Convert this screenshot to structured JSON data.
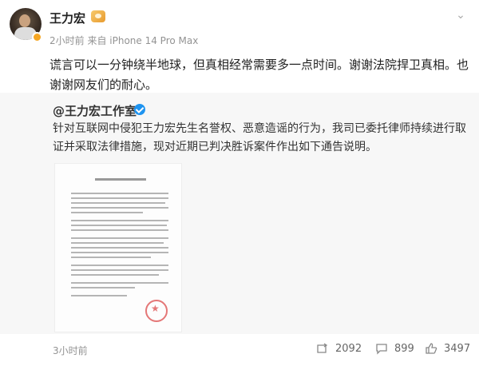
{
  "post": {
    "username": "王力宏",
    "meta": "2小时前  来自 iPhone 14 Pro Max",
    "text": "谎言可以一分钟绕半地球，但真相经常需要多一点时间。谢谢法院捍卫真相。也谢谢网友们的耐心。"
  },
  "retweet": {
    "author": "@王力宏工作室",
    "text": "针对互联网中侵犯王力宏先生名誉权、恶意造谣的行为，我司已委托律师持续进行取证并采取法律措施，现对近期已判决胜诉案件作出如下通告说明。",
    "time": "3小时前",
    "actions": {
      "reposts": "2092",
      "comments": "899",
      "likes": "3497"
    }
  },
  "icons": {
    "more": "chevron-down-icon",
    "repost": "repost-icon",
    "comment": "comment-icon",
    "like": "thumb-up-icon"
  }
}
